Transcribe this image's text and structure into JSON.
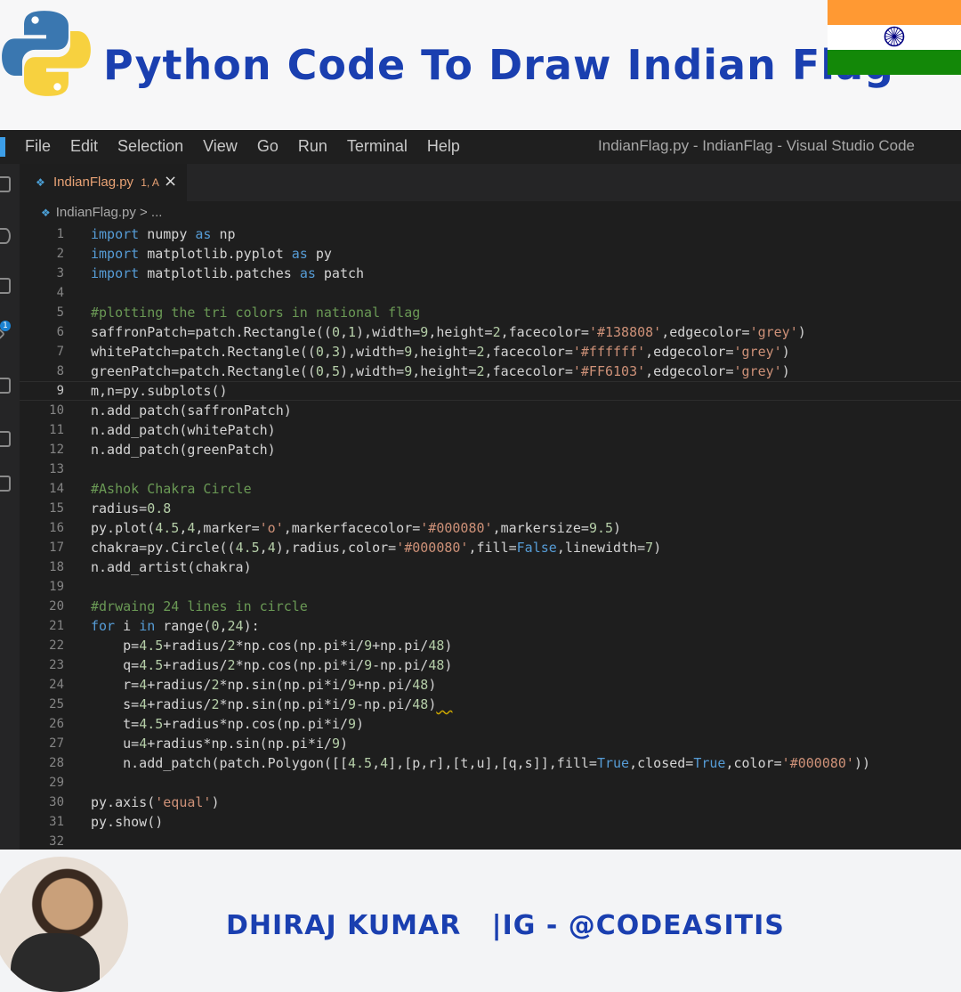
{
  "banner": {
    "title": "Python Code To Draw Indian Flag",
    "logo_icon": "python-logo-icon",
    "flag_icon": "indian-flag-icon",
    "colors": {
      "title": "#1a3fb0",
      "saffron": "#ff9933",
      "green": "#138808",
      "chakra": "#000080"
    }
  },
  "window": {
    "title": "IndianFlag.py - IndianFlag - Visual Studio Code",
    "menu": [
      "File",
      "Edit",
      "Selection",
      "View",
      "Go",
      "Run",
      "Terminal",
      "Help"
    ]
  },
  "tab": {
    "label": "IndianFlag.py",
    "problems": "1, A",
    "close": "×"
  },
  "breadcrumb": {
    "file": "IndianFlag.py",
    "rest": " > ..."
  },
  "activity_badge": "1",
  "current_line": 9,
  "code_lines": [
    [
      {
        "t": "import",
        "c": "kw"
      },
      {
        "t": " numpy ",
        "c": "id"
      },
      {
        "t": "as",
        "c": "kw"
      },
      {
        "t": " np",
        "c": "id"
      }
    ],
    [
      {
        "t": "import",
        "c": "kw"
      },
      {
        "t": " matplotlib.pyplot ",
        "c": "id"
      },
      {
        "t": "as",
        "c": "kw"
      },
      {
        "t": " py",
        "c": "id"
      }
    ],
    [
      {
        "t": "import",
        "c": "kw"
      },
      {
        "t": " matplotlib.patches ",
        "c": "id"
      },
      {
        "t": "as",
        "c": "kw"
      },
      {
        "t": " patch",
        "c": "id"
      }
    ],
    [],
    [
      {
        "t": "#plotting the tri colors in national flag",
        "c": "cm"
      }
    ],
    [
      {
        "t": "saffronPatch=patch.Rectangle((",
        "c": "id"
      },
      {
        "t": "0",
        "c": "num"
      },
      {
        "t": ",",
        "c": "id"
      },
      {
        "t": "1",
        "c": "num"
      },
      {
        "t": "),width=",
        "c": "id"
      },
      {
        "t": "9",
        "c": "num"
      },
      {
        "t": ",height=",
        "c": "id"
      },
      {
        "t": "2",
        "c": "num"
      },
      {
        "t": ",facecolor=",
        "c": "id"
      },
      {
        "t": "'#138808'",
        "c": "str"
      },
      {
        "t": ",edgecolor=",
        "c": "id"
      },
      {
        "t": "'grey'",
        "c": "str"
      },
      {
        "t": ")",
        "c": "id"
      }
    ],
    [
      {
        "t": "whitePatch=patch.Rectangle((",
        "c": "id"
      },
      {
        "t": "0",
        "c": "num"
      },
      {
        "t": ",",
        "c": "id"
      },
      {
        "t": "3",
        "c": "num"
      },
      {
        "t": "),width=",
        "c": "id"
      },
      {
        "t": "9",
        "c": "num"
      },
      {
        "t": ",height=",
        "c": "id"
      },
      {
        "t": "2",
        "c": "num"
      },
      {
        "t": ",facecolor=",
        "c": "id"
      },
      {
        "t": "'#ffffff'",
        "c": "str"
      },
      {
        "t": ",edgecolor=",
        "c": "id"
      },
      {
        "t": "'grey'",
        "c": "str"
      },
      {
        "t": ")",
        "c": "id"
      }
    ],
    [
      {
        "t": "greenPatch=patch.Rectangle((",
        "c": "id"
      },
      {
        "t": "0",
        "c": "num"
      },
      {
        "t": ",",
        "c": "id"
      },
      {
        "t": "5",
        "c": "num"
      },
      {
        "t": "),width=",
        "c": "id"
      },
      {
        "t": "9",
        "c": "num"
      },
      {
        "t": ",height=",
        "c": "id"
      },
      {
        "t": "2",
        "c": "num"
      },
      {
        "t": ",facecolor=",
        "c": "id"
      },
      {
        "t": "'#FF6103'",
        "c": "str"
      },
      {
        "t": ",edgecolor=",
        "c": "id"
      },
      {
        "t": "'grey'",
        "c": "str"
      },
      {
        "t": ")",
        "c": "id"
      }
    ],
    [
      {
        "t": "m,n=py.subplots()",
        "c": "id"
      }
    ],
    [
      {
        "t": "n.add_patch(saffronPatch)",
        "c": "id"
      }
    ],
    [
      {
        "t": "n.add_patch(whitePatch)",
        "c": "id"
      }
    ],
    [
      {
        "t": "n.add_patch(greenPatch)",
        "c": "id"
      }
    ],
    [],
    [
      {
        "t": "#Ashok Chakra Circle",
        "c": "cm"
      }
    ],
    [
      {
        "t": "radius=",
        "c": "id"
      },
      {
        "t": "0.8",
        "c": "num"
      }
    ],
    [
      {
        "t": "py.plot(",
        "c": "id"
      },
      {
        "t": "4.5",
        "c": "num"
      },
      {
        "t": ",",
        "c": "id"
      },
      {
        "t": "4",
        "c": "num"
      },
      {
        "t": ",marker=",
        "c": "id"
      },
      {
        "t": "'o'",
        "c": "str"
      },
      {
        "t": ",markerfacecolor=",
        "c": "id"
      },
      {
        "t": "'#000080'",
        "c": "str"
      },
      {
        "t": ",markersize=",
        "c": "id"
      },
      {
        "t": "9.5",
        "c": "num"
      },
      {
        "t": ")",
        "c": "id"
      }
    ],
    [
      {
        "t": "chakra=py.Circle((",
        "c": "id"
      },
      {
        "t": "4.5",
        "c": "num"
      },
      {
        "t": ",",
        "c": "id"
      },
      {
        "t": "4",
        "c": "num"
      },
      {
        "t": "),radius,color=",
        "c": "id"
      },
      {
        "t": "'#000080'",
        "c": "str"
      },
      {
        "t": ",fill=",
        "c": "id"
      },
      {
        "t": "False",
        "c": "kw"
      },
      {
        "t": ",linewidth=",
        "c": "id"
      },
      {
        "t": "7",
        "c": "num"
      },
      {
        "t": ")",
        "c": "id"
      }
    ],
    [
      {
        "t": "n.add_artist(chakra)",
        "c": "id"
      }
    ],
    [],
    [
      {
        "t": "#drwaing 24 lines in circle",
        "c": "cm"
      }
    ],
    [
      {
        "t": "for",
        "c": "kw"
      },
      {
        "t": " i ",
        "c": "id"
      },
      {
        "t": "in",
        "c": "kw"
      },
      {
        "t": " range(",
        "c": "id"
      },
      {
        "t": "0",
        "c": "num"
      },
      {
        "t": ",",
        "c": "id"
      },
      {
        "t": "24",
        "c": "num"
      },
      {
        "t": "):",
        "c": "id"
      }
    ],
    [
      {
        "t": "    p=",
        "c": "id"
      },
      {
        "t": "4.5",
        "c": "num"
      },
      {
        "t": "+radius/",
        "c": "id"
      },
      {
        "t": "2",
        "c": "num"
      },
      {
        "t": "*np.cos(np.pi*i/",
        "c": "id"
      },
      {
        "t": "9",
        "c": "num"
      },
      {
        "t": "+np.pi/",
        "c": "id"
      },
      {
        "t": "48",
        "c": "num"
      },
      {
        "t": ")",
        "c": "id"
      }
    ],
    [
      {
        "t": "    q=",
        "c": "id"
      },
      {
        "t": "4.5",
        "c": "num"
      },
      {
        "t": "+radius/",
        "c": "id"
      },
      {
        "t": "2",
        "c": "num"
      },
      {
        "t": "*np.cos(np.pi*i/",
        "c": "id"
      },
      {
        "t": "9",
        "c": "num"
      },
      {
        "t": "-np.pi/",
        "c": "id"
      },
      {
        "t": "48",
        "c": "num"
      },
      {
        "t": ")",
        "c": "id"
      }
    ],
    [
      {
        "t": "    r=",
        "c": "id"
      },
      {
        "t": "4",
        "c": "num"
      },
      {
        "t": "+radius/",
        "c": "id"
      },
      {
        "t": "2",
        "c": "num"
      },
      {
        "t": "*np.sin(np.pi*i/",
        "c": "id"
      },
      {
        "t": "9",
        "c": "num"
      },
      {
        "t": "+np.pi/",
        "c": "id"
      },
      {
        "t": "48",
        "c": "num"
      },
      {
        "t": ")",
        "c": "id"
      }
    ],
    [
      {
        "t": "    s=",
        "c": "id"
      },
      {
        "t": "4",
        "c": "num"
      },
      {
        "t": "+radius/",
        "c": "id"
      },
      {
        "t": "2",
        "c": "num"
      },
      {
        "t": "*np.sin(np.pi*i/",
        "c": "id"
      },
      {
        "t": "9",
        "c": "num"
      },
      {
        "t": "-np.pi/",
        "c": "id"
      },
      {
        "t": "48",
        "c": "num"
      },
      {
        "t": ")",
        "c": "id"
      },
      {
        "t": "  ",
        "c": "squig"
      }
    ],
    [
      {
        "t": "    t=",
        "c": "id"
      },
      {
        "t": "4.5",
        "c": "num"
      },
      {
        "t": "+radius*np.cos(np.pi*i/",
        "c": "id"
      },
      {
        "t": "9",
        "c": "num"
      },
      {
        "t": ")",
        "c": "id"
      }
    ],
    [
      {
        "t": "    u=",
        "c": "id"
      },
      {
        "t": "4",
        "c": "num"
      },
      {
        "t": "+radius*np.sin(np.pi*i/",
        "c": "id"
      },
      {
        "t": "9",
        "c": "num"
      },
      {
        "t": ")",
        "c": "id"
      }
    ],
    [
      {
        "t": "    n.add_patch(patch.Polygon([[",
        "c": "id"
      },
      {
        "t": "4.5",
        "c": "num"
      },
      {
        "t": ",",
        "c": "id"
      },
      {
        "t": "4",
        "c": "num"
      },
      {
        "t": "],[p,r],[t,u],[q,s]],fill=",
        "c": "id"
      },
      {
        "t": "True",
        "c": "kw"
      },
      {
        "t": ",closed=",
        "c": "id"
      },
      {
        "t": "True",
        "c": "kw"
      },
      {
        "t": ",color=",
        "c": "id"
      },
      {
        "t": "'#000080'",
        "c": "str"
      },
      {
        "t": "))",
        "c": "id"
      }
    ],
    [],
    [
      {
        "t": "py.axis(",
        "c": "id"
      },
      {
        "t": "'equal'",
        "c": "str"
      },
      {
        "t": ")",
        "c": "id"
      }
    ],
    [
      {
        "t": "py.show()",
        "c": "id"
      }
    ],
    []
  ],
  "footer": {
    "text": "DHIRAJ KUMAR   |IG - @CODEASITIS",
    "avatar_icon": "author-photo"
  }
}
